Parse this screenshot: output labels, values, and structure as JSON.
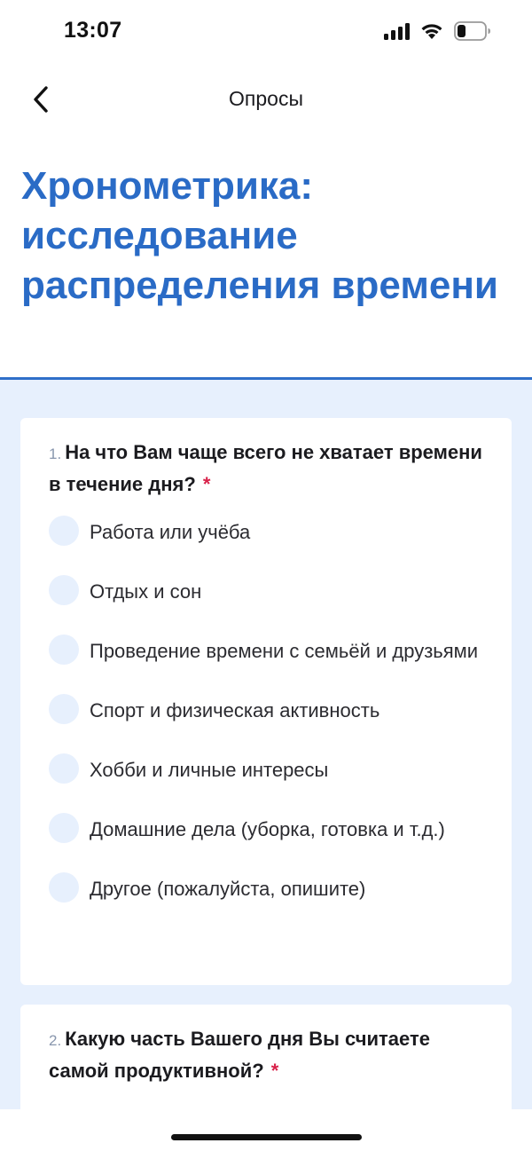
{
  "status_bar": {
    "time": "13:07",
    "icons": [
      "cellular-signal-icon",
      "wifi-icon",
      "battery-icon"
    ]
  },
  "nav": {
    "back_icon": "chevron-left-icon",
    "title": "Опросы"
  },
  "survey": {
    "title": "Хронометрика: исследование распределения времени"
  },
  "colors": {
    "accent": "#2a6bc6",
    "background_content": "#e7f0fd",
    "required": "#d8224a"
  },
  "questions": [
    {
      "number": "1.",
      "text": "На что Вам чаще всего не хватает времени в течение дня?",
      "required_mark": "*",
      "options": [
        "Работа или учёба",
        "Отдых и сон",
        "Проведение времени с семьёй и друзьями",
        "Спорт и физическая активность",
        "Хобби и личные интересы",
        "Домашние дела (уборка, готовка и т.д.)",
        "Другое (пожалуйста, опишите)"
      ]
    },
    {
      "number": "2.",
      "text": "Какую часть Вашего дня Вы считаете самой продуктивной?",
      "required_mark": "*"
    }
  ]
}
